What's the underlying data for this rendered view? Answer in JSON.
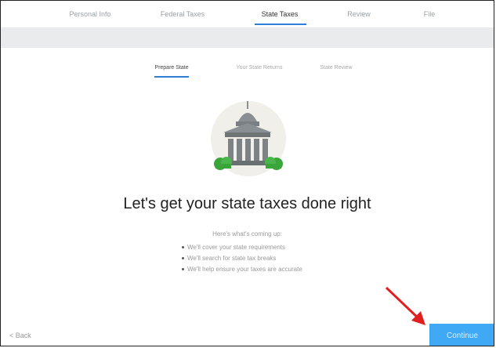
{
  "top_tabs": [
    {
      "label": "Personal Info"
    },
    {
      "label": "Federal Taxes"
    },
    {
      "label": "State Taxes"
    },
    {
      "label": "Review"
    },
    {
      "label": "File"
    }
  ],
  "active_top_tab": "State Taxes",
  "sub_tabs": [
    {
      "label": "Prepare State"
    },
    {
      "label": "Your State Returns"
    },
    {
      "label": "State Review"
    }
  ],
  "active_sub_tab": "Prepare State",
  "main": {
    "headline": "Let's get your state taxes done right",
    "intro": "Here's what's coming up:",
    "bullets": [
      "We'll cover your state requirements",
      "We'll search for state tax breaks",
      "We'll help ensure your taxes are accurate"
    ]
  },
  "footer": {
    "back_label": "< Back",
    "continue_label": "Continue"
  },
  "colors": {
    "accent": "#2f7fd8",
    "continue_bg": "#3fa9f5",
    "annotation_arrow": "#e02020"
  },
  "icons": {
    "illustration": "state-capitol-building",
    "annotation": "red-arrow"
  }
}
